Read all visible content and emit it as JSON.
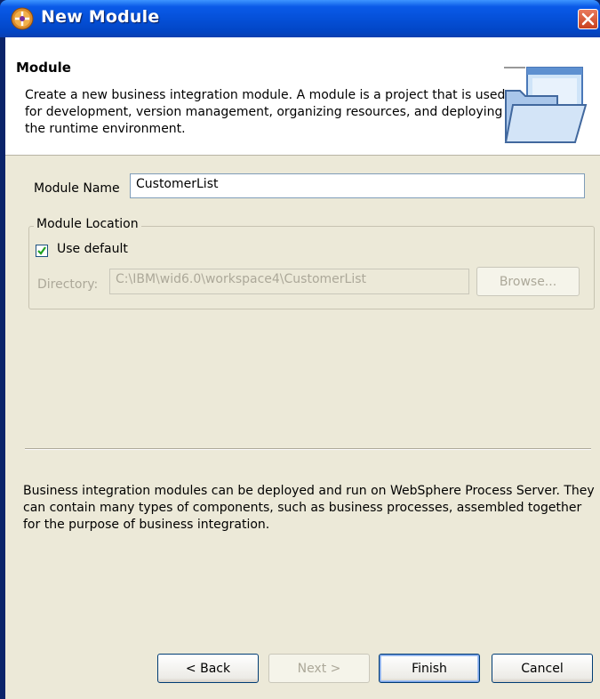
{
  "window": {
    "title": "New Module"
  },
  "header": {
    "title": "Module",
    "description": "Create a new business integration module. A module is a project that is used for development, version management, organizing resources, and deploying to the runtime environment."
  },
  "form": {
    "module_name_label": "Module Name",
    "module_name_value": "CustomerList",
    "location_group_label": "Module Location",
    "use_default_label": "Use default",
    "use_default_checked": true,
    "directory_label": "Directory:",
    "directory_value": "C:\\IBM\\wid6.0\\workspace4\\CustomerList",
    "browse_label": "Browse..."
  },
  "info_text": "Business integration modules can be deployed and run on WebSphere Process Server. They can contain many types of components, such as business processes, assembled together for the purpose of business integration.",
  "buttons": {
    "back": "< Back",
    "next": "Next >",
    "finish": "Finish",
    "cancel": "Cancel"
  },
  "colors": {
    "titlebar": "#0550d8",
    "dialog_bg": "#ece9d8",
    "close_button": "#c8401e"
  }
}
